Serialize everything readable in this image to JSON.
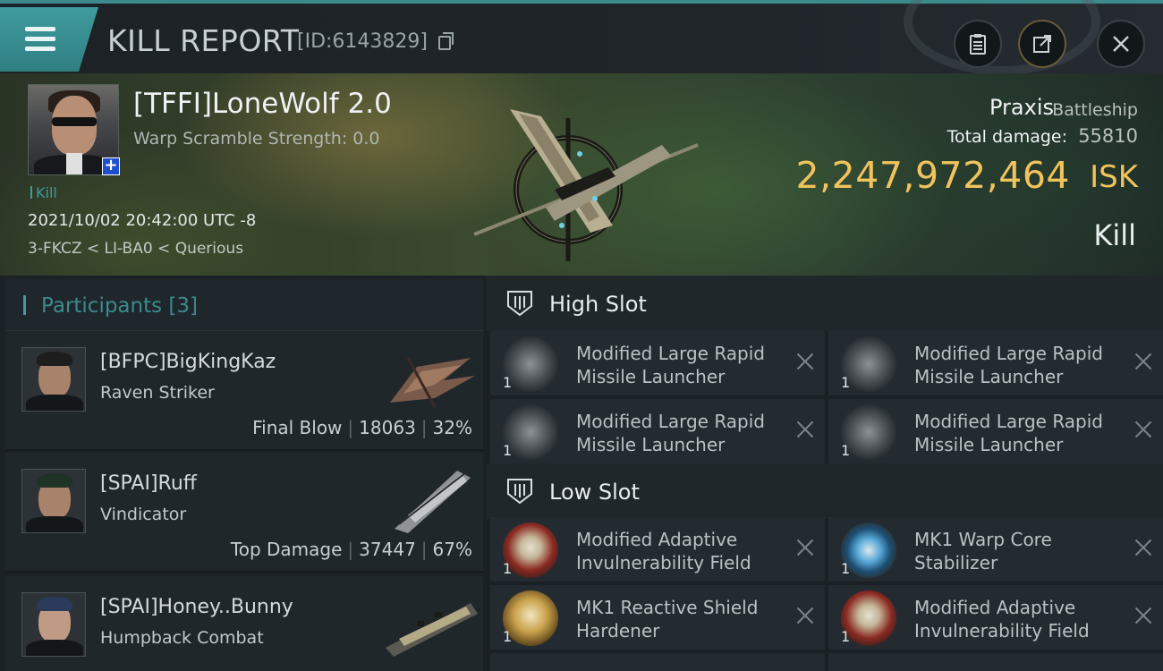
{
  "header": {
    "title": "KILL REPORT",
    "report_id": "[ID:6143829]"
  },
  "victim": {
    "name": "[TFFI]LoneWolf 2.0",
    "warp_scramble": "Warp Scramble Strength: 0.0",
    "tag": "Kill",
    "datetime": "2021/10/02 20:42:00 UTC -8",
    "location": "3-FKCZ < LI-BA0 < Querious",
    "ship_name": "Praxis",
    "ship_class": "Battleship",
    "total_damage_label": "Total damage:",
    "total_damage": "55810",
    "isk_value": "2,247,972,464",
    "isk_unit": "ISK",
    "result": "Kill"
  },
  "participants": {
    "label": "Participants [3]",
    "items": [
      {
        "name": "[BFPC]BigKingKaz",
        "ship": "Raven Striker",
        "role": "Final Blow",
        "damage": "18063",
        "percent": "32%"
      },
      {
        "name": "[SPAI]Ruff",
        "ship": "Vindicator",
        "role": "Top Damage",
        "damage": "37447",
        "percent": "67%"
      },
      {
        "name": "[SPAI]Honey..Bunny",
        "ship": "Humpback Combat",
        "role": "",
        "damage": "",
        "percent": ""
      }
    ]
  },
  "slots": {
    "high": {
      "label": "High Slot",
      "modules": [
        {
          "name": "Modified Large Rapid Missile Launcher",
          "qty": "1",
          "icon": "launcher-icon"
        },
        {
          "name": "Modified Large Rapid Missile Launcher",
          "qty": "1",
          "icon": "launcher-icon"
        },
        {
          "name": "Modified Large Rapid Missile Launcher",
          "qty": "1",
          "icon": "launcher-icon"
        },
        {
          "name": "Modified Large Rapid Missile Launcher",
          "qty": "1",
          "icon": "launcher-icon"
        }
      ]
    },
    "low": {
      "label": "Low Slot",
      "modules": [
        {
          "name": "Modified Adaptive Invulnerability Field",
          "qty": "1",
          "icon": "invulnerability-field-icon"
        },
        {
          "name": "MK1 Warp Core Stabilizer",
          "qty": "1",
          "icon": "warp-core-stabilizer-icon"
        },
        {
          "name": "MK1 Reactive Shield Hardener",
          "qty": "1",
          "icon": "shield-hardener-icon"
        },
        {
          "name": "Modified Adaptive Invulnerability Field",
          "qty": "1",
          "icon": "invulnerability-field-icon"
        }
      ]
    }
  },
  "colors": {
    "accent": "#3f9b9d",
    "isk": "#f1c35c"
  }
}
